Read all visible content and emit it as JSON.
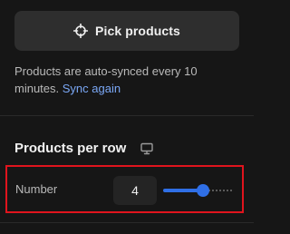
{
  "pick_button": {
    "label": "Pick products",
    "icon": "crosshair-icon"
  },
  "sync": {
    "text": "Products are auto-synced every 10 minutes.",
    "link": "Sync again"
  },
  "products_per_row": {
    "title": "Products per row",
    "icon": "monitor-icon",
    "number_label": "Number",
    "value": "4",
    "slider_fraction": 0.58
  },
  "colors": {
    "accent": "#2f6fe6",
    "link": "#7aa7f5",
    "highlight_border": "#e0141d",
    "background": "#161616"
  }
}
